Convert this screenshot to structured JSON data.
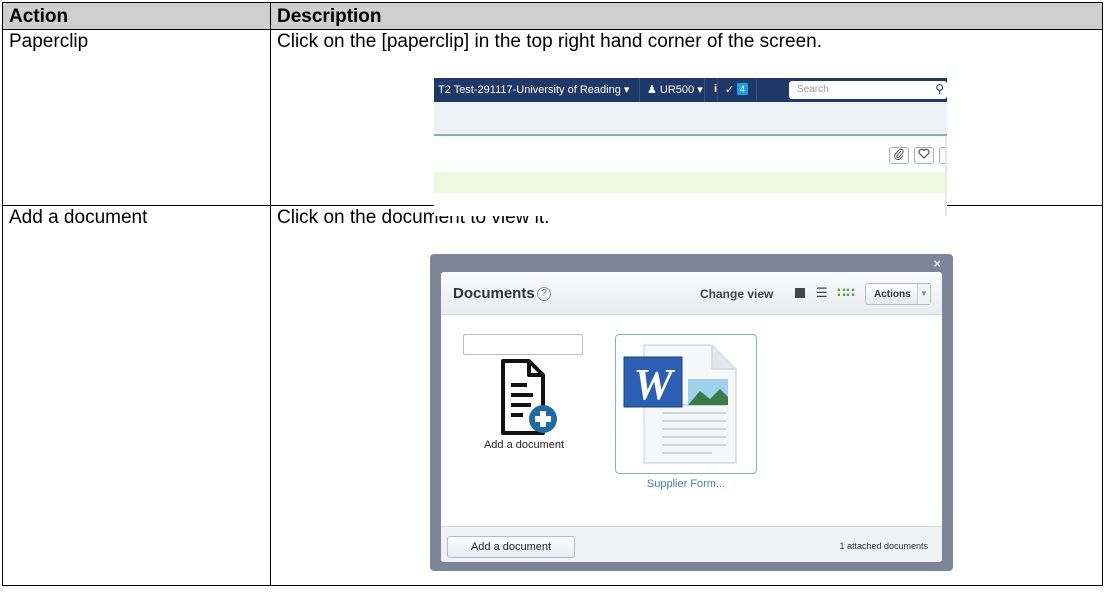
{
  "table": {
    "headers": {
      "action": "Action",
      "description": "Description"
    },
    "rows": [
      {
        "action": "Paperclip",
        "description": "Click on the [paperclip] in the top right hand corner of the screen."
      },
      {
        "action": "Add a document",
        "description": "Click on the document to view it."
      }
    ]
  },
  "screenshot1": {
    "org": "T2 Test-291117-University of Reading",
    "user": "UR500",
    "info": "i",
    "tasks_count": "4",
    "search_placeholder": "Search"
  },
  "screenshot2": {
    "close": "×",
    "title": "Documents",
    "help": "?",
    "change_view": "Change view",
    "actions": "Actions",
    "new_doc_label": "Add a document",
    "doc_name": "Supplier Form...",
    "footer_button": "Add a document",
    "attached_count": "1 attached documents"
  }
}
